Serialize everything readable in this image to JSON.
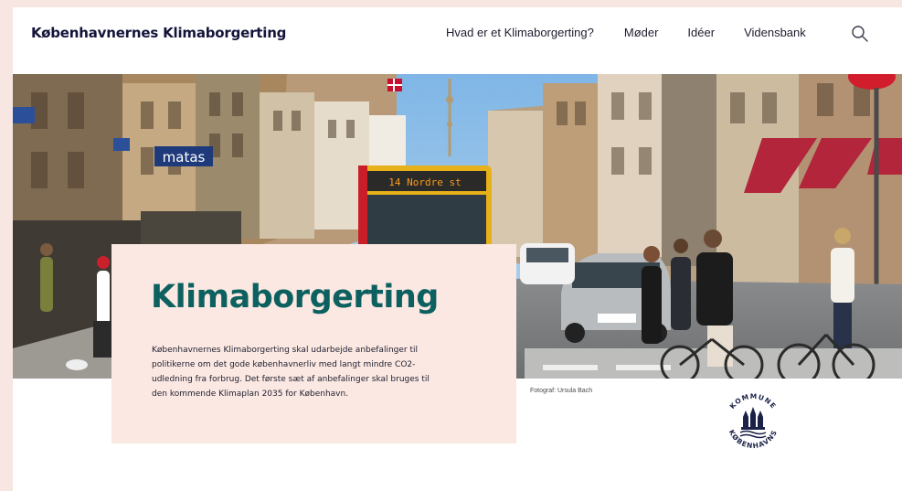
{
  "header": {
    "site_title": "Københavnernes Klimaborgerting",
    "nav": [
      {
        "label": "Hvad er et Klimaborgerting?"
      },
      {
        "label": "Møder"
      },
      {
        "label": "Idéer"
      },
      {
        "label": "Vidensbank"
      }
    ],
    "search_icon": "search-icon"
  },
  "hero": {
    "image": "street-scene-photo",
    "sign_text": "matas",
    "bus_destination": "14 Nordre st"
  },
  "photo_credit": "Fotograf: Ursula Bach",
  "intro": {
    "title": "Klimaborgerting",
    "text_lines": [
      "Københavnernes Klimaborgerting skal udarbejde anbefalinger til",
      "politikerne om det gode københavnerliv med langt mindre CO2-",
      "udledning fra forbrug. Det første sæt af anbefalinger skal bruges til",
      "den kommende Klimaplan 2035 for København."
    ]
  },
  "logo": {
    "name": "kobenhavns-kommune-logo",
    "ring_top": "KOMMUNE",
    "ring_bottom": "KØBENHAVNS"
  },
  "colors": {
    "page_background": "#f7e6e1",
    "card_background": "#fbe8e2",
    "title_color": "#0c6160",
    "header_text": "#14143a"
  }
}
